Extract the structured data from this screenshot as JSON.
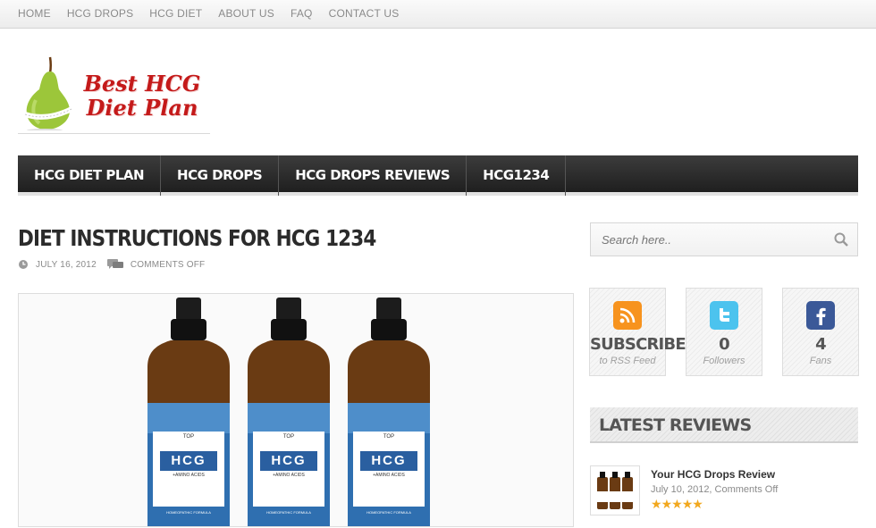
{
  "top_nav": [
    "HOME",
    "HCG DROPS",
    "HCG DIET",
    "ABOUT US",
    "FAQ",
    "CONTACT US"
  ],
  "logo": {
    "line1": "Best HCG",
    "line2": "Diet Plan"
  },
  "main_nav": [
    "HCG DIET PLAN",
    "HCG DROPS",
    "HCG DROPS REVIEWS",
    "HCG1234"
  ],
  "post": {
    "title": "DIET INSTRUCTIONS FOR HCG 1234",
    "date": "JULY 16, 2012",
    "comments": "COMMENTS OFF"
  },
  "bottle_label": {
    "top": "TOP",
    "brand": "HCG",
    "sub": "+AMINO ACIDS",
    "footer": "HOMEOPATHIC FORMULA"
  },
  "search": {
    "placeholder": "Search here.."
  },
  "social": [
    {
      "big": "SUBSCRIBE",
      "sub": "to RSS Feed",
      "icon": "rss-icon"
    },
    {
      "big": "0",
      "sub": "Followers",
      "icon": "twitter-icon"
    },
    {
      "big": "4",
      "sub": "Fans",
      "icon": "facebook-icon"
    }
  ],
  "latest_reviews": {
    "heading": "LATEST REVIEWS",
    "item": {
      "title": "Your HCG Drops Review",
      "meta": "July 10, 2012, Comments Off",
      "rating": 5
    }
  },
  "colors": {
    "nav_bg": "#2a2a2a",
    "logo_red": "#c41a1a",
    "star": "#f2a81e",
    "rss": "#f7931e",
    "twitter": "#4cc3ee",
    "facebook": "#3b5998"
  }
}
